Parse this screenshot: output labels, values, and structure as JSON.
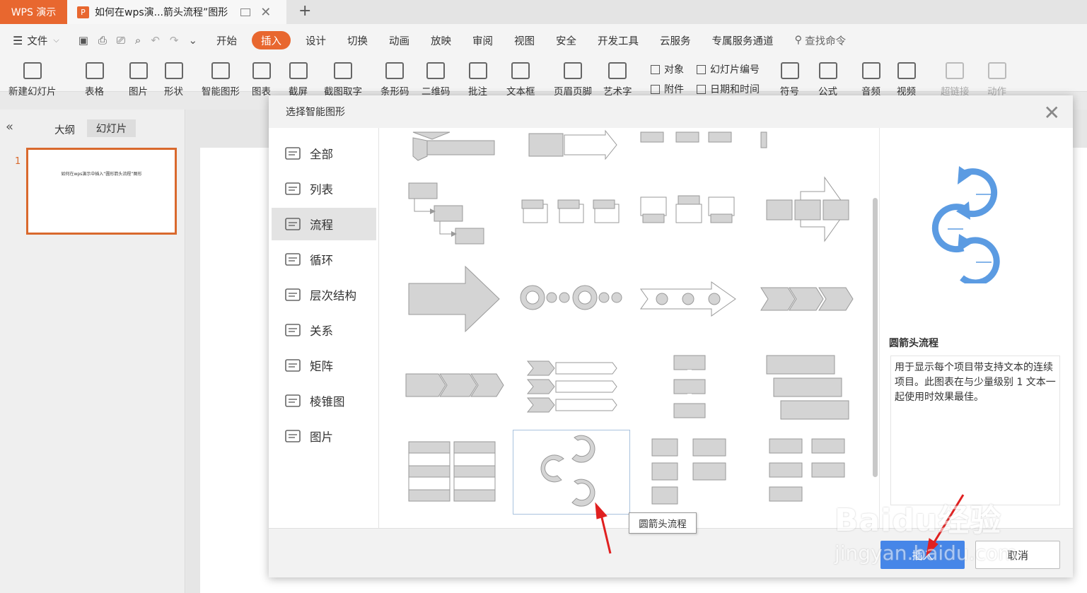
{
  "titlebar": {
    "app_label": "WPS 演示",
    "doc_tab_icon": "P",
    "doc_tab_title": "如何在wps演...箭头流程”图形",
    "new_tab": "+"
  },
  "menu": {
    "file_label": "文件",
    "items": [
      "开始",
      "插入",
      "设计",
      "切换",
      "动画",
      "放映",
      "审阅",
      "视图",
      "安全",
      "开发工具",
      "云服务",
      "专属服务通道"
    ],
    "active": "插入",
    "search_label": "查找命令"
  },
  "ribbon": {
    "buttons": [
      "新建幻灯片",
      "表格",
      "图片",
      "形状",
      "智能图形",
      "图表",
      "截屏",
      "截图取字",
      "条形码",
      "二维码",
      "批注",
      "文本框",
      "页眉页脚",
      "艺术字",
      "符号",
      "公式",
      "音频",
      "视频",
      "超链接",
      "动作"
    ],
    "small_buttons": [
      "对象",
      "幻灯片编号",
      "附件",
      "日期和时间"
    ]
  },
  "left_panel": {
    "tabs": [
      "大纲",
      "幻灯片"
    ],
    "active_tab": "幻灯片",
    "slide_number": "1",
    "slide_thumb_text": "如何在wps演示中插入“圆形箭头流程”图形"
  },
  "dialog": {
    "title": "选择智能图形",
    "categories": [
      "全部",
      "列表",
      "流程",
      "循环",
      "层次结构",
      "关系",
      "矩阵",
      "棱锥图",
      "图片"
    ],
    "active_category": "流程",
    "selected_item": "圆箭头流程",
    "tooltip": "圆箭头流程",
    "preview_title": "圆箭头流程",
    "preview_description": "用于显示每个项目带支持文本的连续项目。此图表在与少量级别 1 文本一起使用时效果最佳。",
    "insert_label": "插入",
    "cancel_label": "取消"
  },
  "watermark": {
    "brand": "Baidu经验",
    "url": "jingyan.baidu.com"
  },
  "colors": {
    "accent": "#e8672f",
    "primary_button": "#4686e8",
    "preview_blue": "#5b9be2",
    "shape_gray": "#d4d4d4",
    "annotation_red": "#e02020"
  }
}
